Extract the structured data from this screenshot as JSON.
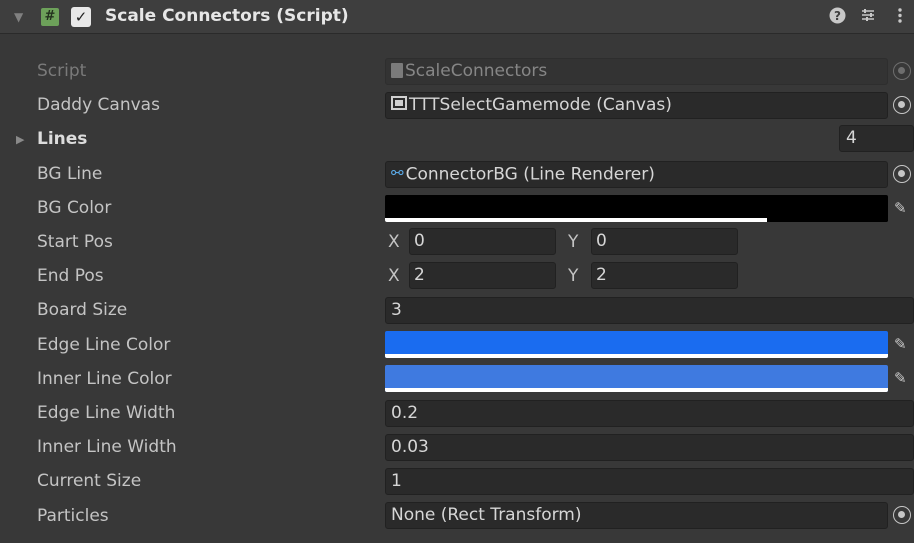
{
  "header": {
    "script_icon": "#",
    "enabled_check": "✓",
    "title": "Scale Connectors (Script)",
    "icons": [
      "help-icon",
      "presets-icon",
      "kebab-menu-icon"
    ],
    "help_glyph": "❓",
    "presets_glyph": "⇵",
    "menu_glyph": "⋮"
  },
  "fields": {
    "script": {
      "label": "Script",
      "value": "ScaleConnectors"
    },
    "daddy_canvas": {
      "label": "Daddy Canvas",
      "value": "TTTSelectGamemode (Canvas)"
    },
    "lines": {
      "label": "Lines",
      "count": "4"
    },
    "bg_line": {
      "label": "BG Line",
      "value": "ConnectorBG (Line Renderer)"
    },
    "bg_color": {
      "label": "BG Color",
      "color": "#000000",
      "alpha": 0.76
    },
    "start_pos": {
      "label": "Start Pos",
      "x_label": "X",
      "x": "0",
      "y_label": "Y",
      "y": "0"
    },
    "end_pos": {
      "label": "End Pos",
      "x_label": "X",
      "x": "2",
      "y_label": "Y",
      "y": "2"
    },
    "board_size": {
      "label": "Board Size",
      "value": "3"
    },
    "edge_line_color": {
      "label": "Edge Line Color",
      "color": "#1a6cf0",
      "alpha": 1.0
    },
    "inner_line_color": {
      "label": "Inner Line Color",
      "color": "#3f7ae0",
      "alpha": 1.0
    },
    "edge_line_width": {
      "label": "Edge Line Width",
      "value": "0.2"
    },
    "inner_line_width": {
      "label": "Inner Line Width",
      "value": "0.03"
    },
    "current_size": {
      "label": "Current Size",
      "value": "1"
    },
    "particles": {
      "label": "Particles",
      "value": "None (Rect Transform)"
    }
  }
}
